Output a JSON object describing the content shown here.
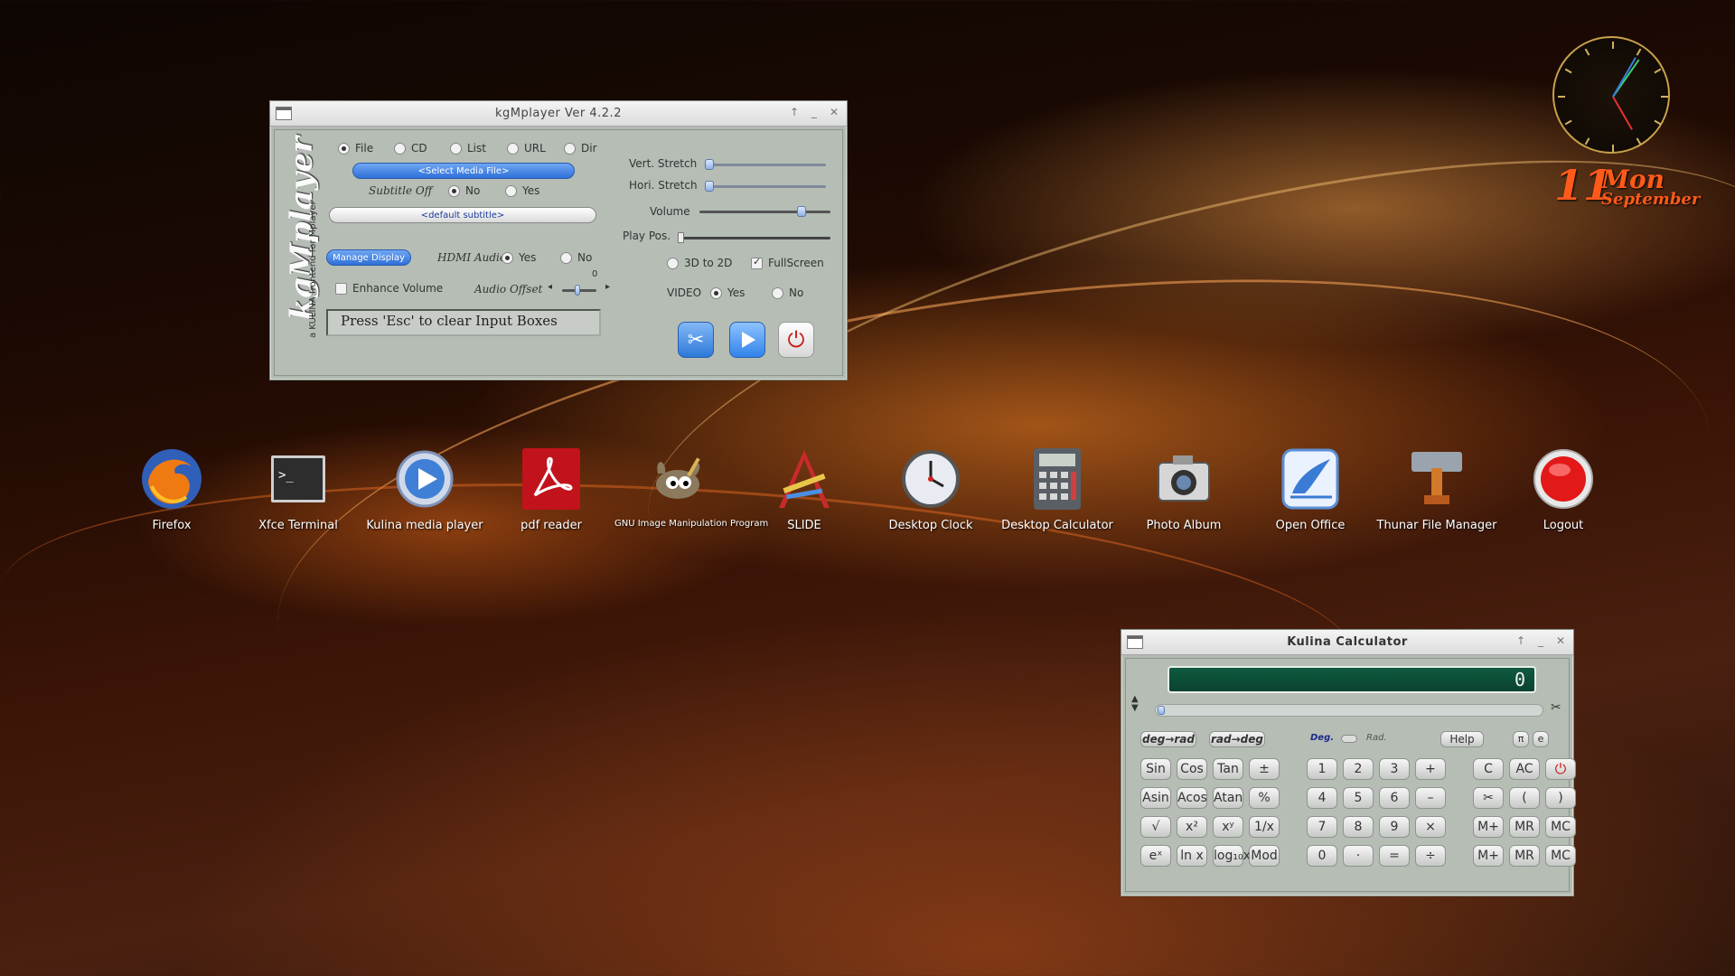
{
  "kgmplayer": {
    "title": "kgMplayer Ver 4.2.2",
    "brand": "kgMplayer",
    "brand_subtitle": "a KULINA frontend for Mplayer",
    "source_options": [
      "File",
      "CD",
      "List",
      "URL",
      "Dir"
    ],
    "source_selected": "File",
    "select_media_label": "<Select Media File>",
    "subtitle_label": "Subtitle Off",
    "subtitle_no": "No",
    "subtitle_yes": "Yes",
    "default_subtitle_label": "<default subtitle>",
    "manage_display_label": "Manage Display",
    "hdmi_audio_label": "HDMI Audio",
    "hdmi_yes": "Yes",
    "hdmi_no": "No",
    "enhance_volume_label": "Enhance Volume",
    "audio_offset_label": "Audio Offset",
    "audio_offset_value": "0",
    "input_hint": "Press 'Esc' to clear Input Boxes",
    "vert_stretch_label": "Vert. Stretch",
    "hori_stretch_label": "Hori. Stretch",
    "volume_label": "Volume",
    "play_pos_label": "Play Pos.",
    "mode_3d_label": "3D to 2D",
    "fullscreen_label": "FullScreen",
    "video_label": "VIDEO",
    "video_yes": "Yes",
    "video_no": "No",
    "volume_level": 0.8,
    "play_position": 0.0
  },
  "desktop_icons": [
    {
      "label": "Firefox",
      "icon": "firefox-icon"
    },
    {
      "label": "Xfce Terminal",
      "icon": "terminal-icon"
    },
    {
      "label": "Kulina media player",
      "icon": "media-player-icon"
    },
    {
      "label": "pdf reader",
      "icon": "pdf-icon"
    },
    {
      "label": "GNU Image Manipulation Program",
      "icon": "gimp-icon"
    },
    {
      "label": "SLIDE",
      "icon": "slide-icon"
    },
    {
      "label": "Desktop Clock",
      "icon": "clock-icon"
    },
    {
      "label": "Desktop Calculator",
      "icon": "calculator-icon"
    },
    {
      "label": "Photo Album",
      "icon": "camera-icon"
    },
    {
      "label": "Open Office",
      "icon": "office-icon"
    },
    {
      "label": "Thunar File Manager",
      "icon": "file-manager-icon"
    },
    {
      "label": "Logout",
      "icon": "logout-icon"
    }
  ],
  "date_widget": {
    "day": "11",
    "weekday": "Mon",
    "month": "September"
  },
  "calculator": {
    "title": "Kulina Calculator",
    "display_value": "0",
    "deg_to_rad": "deg→rad",
    "rad_to_deg": "rad→deg",
    "deg_label": "Deg.",
    "rad_label": "Rad.",
    "help_label": "Help",
    "pi_label": "π",
    "e_label": "e",
    "rows": [
      [
        "Sin",
        "Cos",
        "Tan",
        "±",
        "1",
        "2",
        "3",
        "+",
        "C",
        "AC",
        "⏻"
      ],
      [
        "Asin",
        "Acos",
        "Atan",
        "%",
        "4",
        "5",
        "6",
        "–",
        "✂",
        "(",
        ")"
      ],
      [
        "√",
        "x²",
        "xʸ",
        "1/x",
        "7",
        "8",
        "9",
        "×",
        "M+",
        "MR",
        "MC"
      ],
      [
        "eˣ",
        "ln x",
        "log₁₀x",
        "Mod",
        "0",
        "·",
        "=",
        "÷",
        "M+",
        "MR",
        "MC"
      ]
    ]
  }
}
